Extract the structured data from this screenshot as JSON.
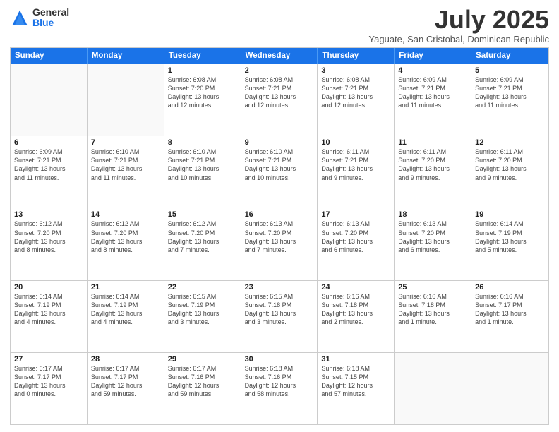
{
  "logo": {
    "general": "General",
    "blue": "Blue"
  },
  "title": "July 2025",
  "subtitle": "Yaguate, San Cristobal, Dominican Republic",
  "header_days": [
    "Sunday",
    "Monday",
    "Tuesday",
    "Wednesday",
    "Thursday",
    "Friday",
    "Saturday"
  ],
  "weeks": [
    [
      {
        "day": "",
        "info": ""
      },
      {
        "day": "",
        "info": ""
      },
      {
        "day": "1",
        "info": "Sunrise: 6:08 AM\nSunset: 7:20 PM\nDaylight: 13 hours\nand 12 minutes."
      },
      {
        "day": "2",
        "info": "Sunrise: 6:08 AM\nSunset: 7:21 PM\nDaylight: 13 hours\nand 12 minutes."
      },
      {
        "day": "3",
        "info": "Sunrise: 6:08 AM\nSunset: 7:21 PM\nDaylight: 13 hours\nand 12 minutes."
      },
      {
        "day": "4",
        "info": "Sunrise: 6:09 AM\nSunset: 7:21 PM\nDaylight: 13 hours\nand 11 minutes."
      },
      {
        "day": "5",
        "info": "Sunrise: 6:09 AM\nSunset: 7:21 PM\nDaylight: 13 hours\nand 11 minutes."
      }
    ],
    [
      {
        "day": "6",
        "info": "Sunrise: 6:09 AM\nSunset: 7:21 PM\nDaylight: 13 hours\nand 11 minutes."
      },
      {
        "day": "7",
        "info": "Sunrise: 6:10 AM\nSunset: 7:21 PM\nDaylight: 13 hours\nand 11 minutes."
      },
      {
        "day": "8",
        "info": "Sunrise: 6:10 AM\nSunset: 7:21 PM\nDaylight: 13 hours\nand 10 minutes."
      },
      {
        "day": "9",
        "info": "Sunrise: 6:10 AM\nSunset: 7:21 PM\nDaylight: 13 hours\nand 10 minutes."
      },
      {
        "day": "10",
        "info": "Sunrise: 6:11 AM\nSunset: 7:21 PM\nDaylight: 13 hours\nand 9 minutes."
      },
      {
        "day": "11",
        "info": "Sunrise: 6:11 AM\nSunset: 7:20 PM\nDaylight: 13 hours\nand 9 minutes."
      },
      {
        "day": "12",
        "info": "Sunrise: 6:11 AM\nSunset: 7:20 PM\nDaylight: 13 hours\nand 9 minutes."
      }
    ],
    [
      {
        "day": "13",
        "info": "Sunrise: 6:12 AM\nSunset: 7:20 PM\nDaylight: 13 hours\nand 8 minutes."
      },
      {
        "day": "14",
        "info": "Sunrise: 6:12 AM\nSunset: 7:20 PM\nDaylight: 13 hours\nand 8 minutes."
      },
      {
        "day": "15",
        "info": "Sunrise: 6:12 AM\nSunset: 7:20 PM\nDaylight: 13 hours\nand 7 minutes."
      },
      {
        "day": "16",
        "info": "Sunrise: 6:13 AM\nSunset: 7:20 PM\nDaylight: 13 hours\nand 7 minutes."
      },
      {
        "day": "17",
        "info": "Sunrise: 6:13 AM\nSunset: 7:20 PM\nDaylight: 13 hours\nand 6 minutes."
      },
      {
        "day": "18",
        "info": "Sunrise: 6:13 AM\nSunset: 7:20 PM\nDaylight: 13 hours\nand 6 minutes."
      },
      {
        "day": "19",
        "info": "Sunrise: 6:14 AM\nSunset: 7:19 PM\nDaylight: 13 hours\nand 5 minutes."
      }
    ],
    [
      {
        "day": "20",
        "info": "Sunrise: 6:14 AM\nSunset: 7:19 PM\nDaylight: 13 hours\nand 4 minutes."
      },
      {
        "day": "21",
        "info": "Sunrise: 6:14 AM\nSunset: 7:19 PM\nDaylight: 13 hours\nand 4 minutes."
      },
      {
        "day": "22",
        "info": "Sunrise: 6:15 AM\nSunset: 7:19 PM\nDaylight: 13 hours\nand 3 minutes."
      },
      {
        "day": "23",
        "info": "Sunrise: 6:15 AM\nSunset: 7:18 PM\nDaylight: 13 hours\nand 3 minutes."
      },
      {
        "day": "24",
        "info": "Sunrise: 6:16 AM\nSunset: 7:18 PM\nDaylight: 13 hours\nand 2 minutes."
      },
      {
        "day": "25",
        "info": "Sunrise: 6:16 AM\nSunset: 7:18 PM\nDaylight: 13 hours\nand 1 minute."
      },
      {
        "day": "26",
        "info": "Sunrise: 6:16 AM\nSunset: 7:17 PM\nDaylight: 13 hours\nand 1 minute."
      }
    ],
    [
      {
        "day": "27",
        "info": "Sunrise: 6:17 AM\nSunset: 7:17 PM\nDaylight: 13 hours\nand 0 minutes."
      },
      {
        "day": "28",
        "info": "Sunrise: 6:17 AM\nSunset: 7:17 PM\nDaylight: 12 hours\nand 59 minutes."
      },
      {
        "day": "29",
        "info": "Sunrise: 6:17 AM\nSunset: 7:16 PM\nDaylight: 12 hours\nand 59 minutes."
      },
      {
        "day": "30",
        "info": "Sunrise: 6:18 AM\nSunset: 7:16 PM\nDaylight: 12 hours\nand 58 minutes."
      },
      {
        "day": "31",
        "info": "Sunrise: 6:18 AM\nSunset: 7:15 PM\nDaylight: 12 hours\nand 57 minutes."
      },
      {
        "day": "",
        "info": ""
      },
      {
        "day": "",
        "info": ""
      }
    ]
  ]
}
